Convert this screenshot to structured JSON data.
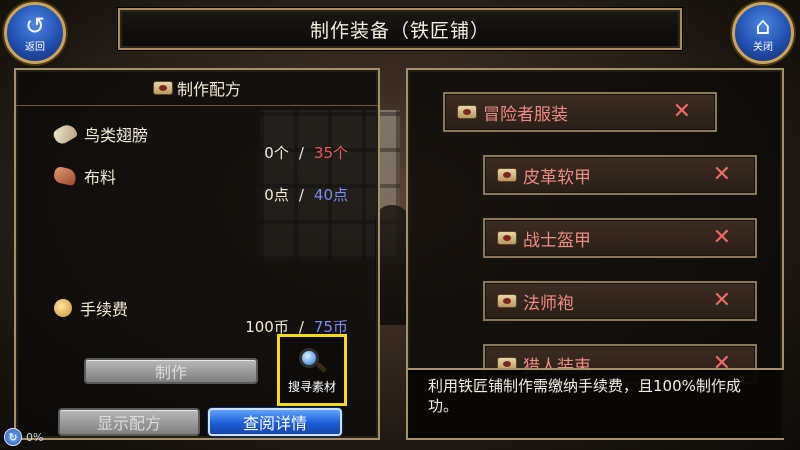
{
  "header": {
    "title": "制作装备（铁匠铺）",
    "back_label": "返回",
    "close_label": "关闭",
    "back_icon": "↺",
    "close_icon": "⌂"
  },
  "left_panel": {
    "title": "制作配方",
    "materials": [
      {
        "name": "鸟类翅膀",
        "icon": "feather-icon",
        "have": "0个",
        "need": "35个"
      },
      {
        "name": "布料",
        "icon": "cloth-icon",
        "have": "0点",
        "need": "40点"
      }
    ],
    "fee": {
      "name": "手续费",
      "icon": "coins-icon",
      "have": "100币",
      "need": "75币"
    },
    "separator": "/",
    "craft_button": "制作",
    "search_button": "搜寻素材",
    "show_recipe_button": "显示配方",
    "view_details_button": "查阅详情"
  },
  "right_panel": {
    "recipes": [
      {
        "label": "冒险者服装",
        "close": "✕"
      },
      {
        "label": "皮革软甲",
        "close": "✕"
      },
      {
        "label": "战士盔甲",
        "close": "✕"
      },
      {
        "label": "法师袍",
        "close": "✕"
      },
      {
        "label": "猎人装束",
        "close": "✕"
      }
    ],
    "description": "利用铁匠铺制作需缴纳手续费，且100%制作成功。"
  },
  "status": {
    "percent": "0%"
  },
  "colors": {
    "insufficient": "#ee5a56",
    "requirement_blue": "#7a8cf5",
    "recipe_text": "#ef8b84",
    "highlight_border": "#f2dc1a"
  }
}
